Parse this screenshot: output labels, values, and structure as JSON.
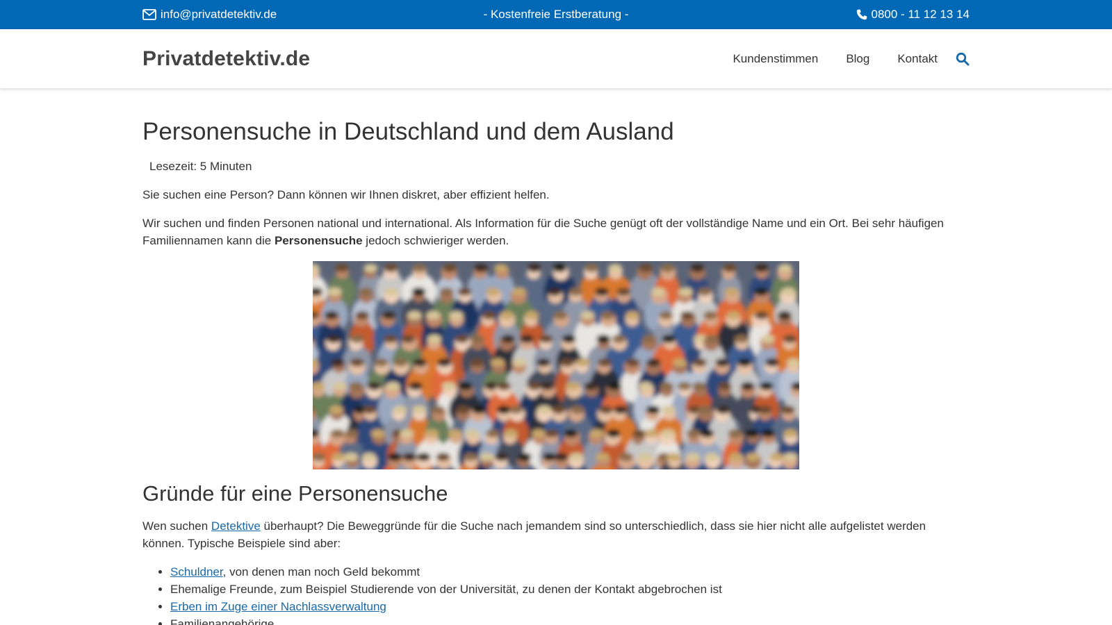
{
  "topbar": {
    "email": "info@privatdetektiv.de",
    "center_text": "- Kostenfreie Erstberatung -",
    "phone": "0800 - 11 12 13 14",
    "background_color": "#0068b4",
    "email_icon": "envelope-icon",
    "phone_icon": "phone-icon"
  },
  "header": {
    "brand": "Privatdetektiv.de",
    "nav": [
      "Kundenstimmen",
      "Blog",
      "Kontakt"
    ],
    "search_icon": "search-icon",
    "accent_color": "#1a69a8"
  },
  "article": {
    "title": "Personensuche in Deutschland und dem Ausland",
    "reading_time": "Lesezeit: 5 Minuten",
    "intro": "Sie suchen eine Person? Dann können wir Ihnen diskret, aber effizient helfen.",
    "para2_before": "Wir suchen und finden Personen national und international. Als Information für die Suche genügt oft der vollständige Name und ein Ort. Bei sehr häufigen Familiennamen kann die ",
    "para2_bold": "Personensuche",
    "para2_after": " jedoch schwieriger werden.",
    "section_title": "Gründe für eine Personensuche",
    "section_para_before": "Wen suchen ",
    "section_para_link": "Detektive",
    "section_para_after": " überhaupt? Die Beweggründe für die Suche nach jemandem sind so unterschiedlich, dass sie hier nicht alle aufgelistet werden können. Typische Beispiele sind aber:",
    "list": {
      "item1_link": "Schuldner",
      "item1_rest": ", von denen man noch Geld bekommt",
      "item2": "Ehemalige Freunde, zum Beispiel Studierende von der Universität, zu denen der Kontakt abgebrochen ist",
      "item3_link": "Erben im Zuge einer Nachlassverwaltung",
      "item4": "Familienangehörige"
    }
  }
}
